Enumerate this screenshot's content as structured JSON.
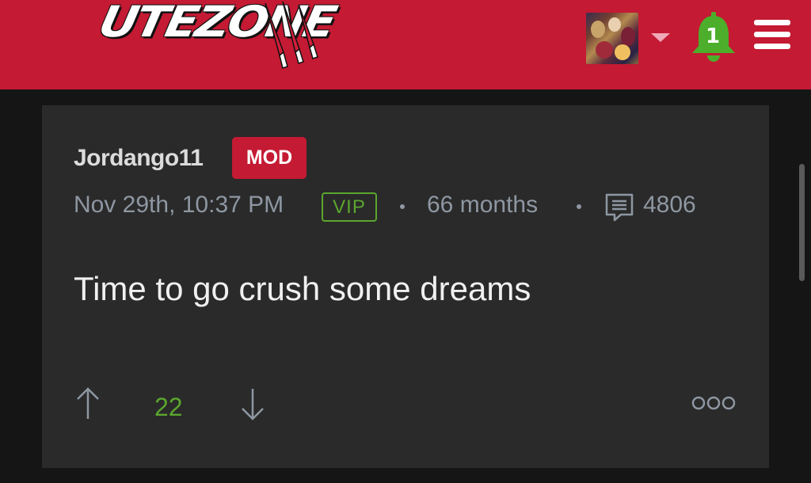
{
  "header": {
    "logo_text": "UTEZONE",
    "bell_count": "1",
    "colors": {
      "brand": "#c41a33",
      "bell": "#4cae2a",
      "caret": "#f1a8b8"
    },
    "icons": [
      "avatar",
      "dropdown-caret-icon",
      "bell-icon",
      "hamburger-menu-icon"
    ]
  },
  "post": {
    "username": "Jordango11",
    "badge": "MOD",
    "timestamp": "Nov 29th, 10:37 PM",
    "vip_label": "VIP",
    "tenure": "66 months",
    "comment_count": "4806",
    "body": "Time to go crush some dreams",
    "score": "22",
    "colors": {
      "card": "#2a2a2a",
      "meta": "#8e97a2",
      "vip": "#5ba62e",
      "score": "#5ba62e"
    }
  }
}
